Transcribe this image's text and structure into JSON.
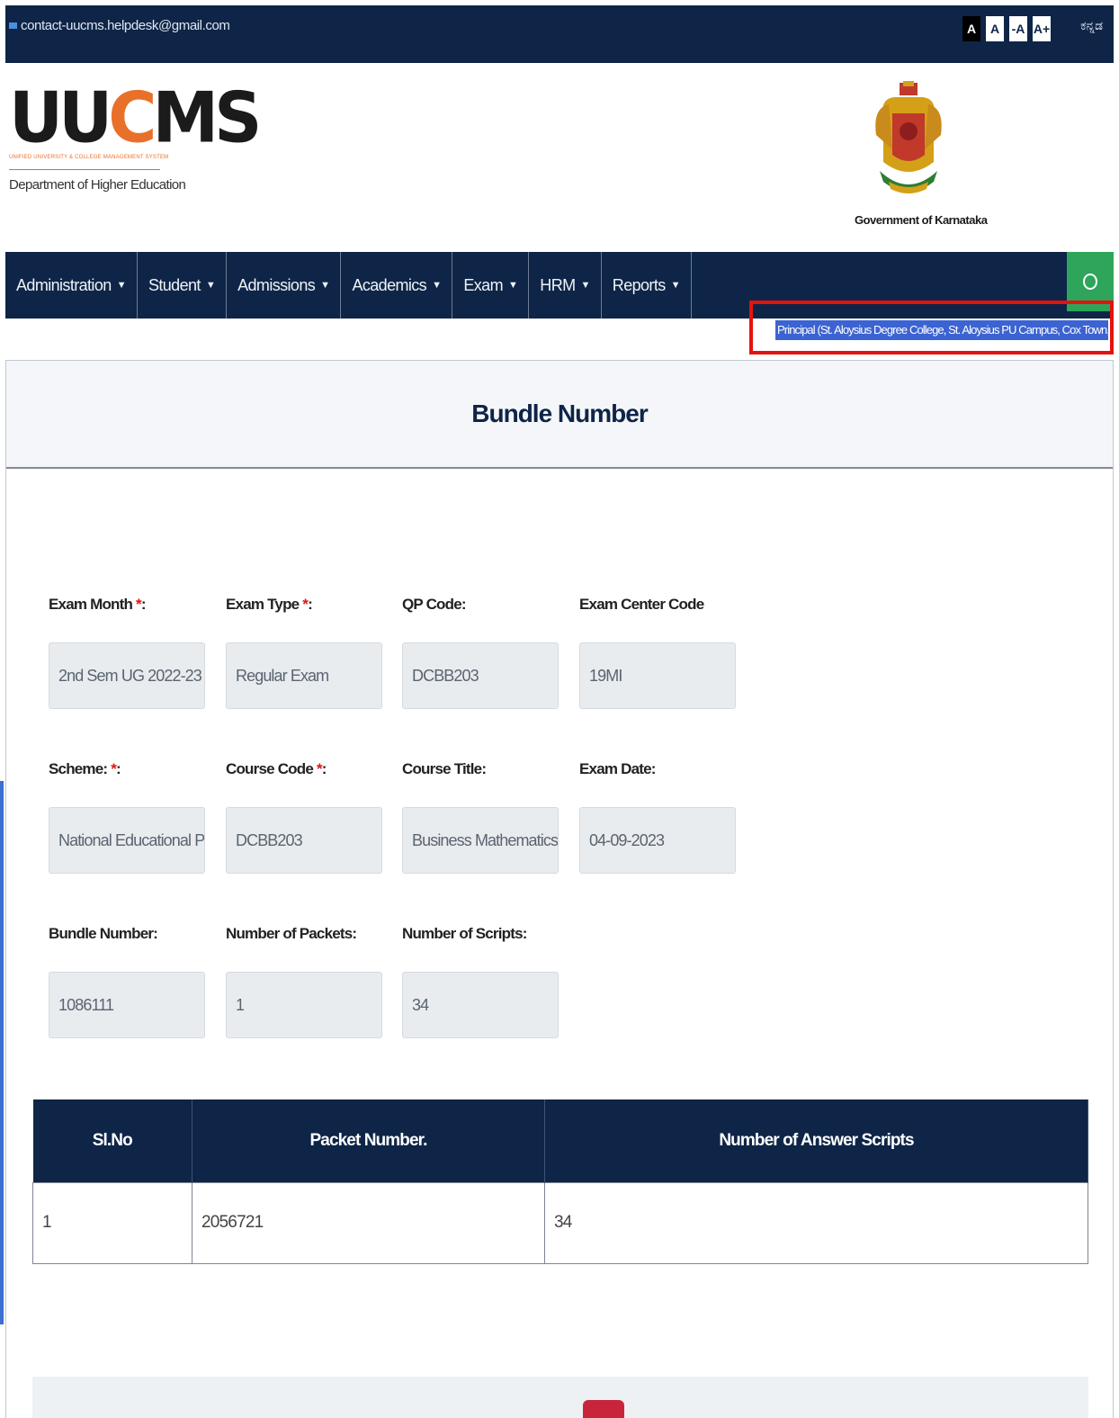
{
  "topbar": {
    "email": "contact-uucms.helpdesk@gmail.com",
    "font_controls": [
      "A",
      "A",
      "-A",
      "A+"
    ],
    "language": "ಕನ್ನಡ"
  },
  "header": {
    "logo_main_left": "UU",
    "logo_main_accent": "C",
    "logo_main_right": "MS",
    "logo_tagline": "UNIFIED UNIVERSITY & COLLEGE MANAGEMENT SYSTEM",
    "department": "Department of Higher Education",
    "emblem_caption": "Government of Karnataka"
  },
  "nav": {
    "items": [
      {
        "label": "Administration"
      },
      {
        "label": "Student"
      },
      {
        "label": "Admissions"
      },
      {
        "label": "Academics"
      },
      {
        "label": "Exam"
      },
      {
        "label": "HRM"
      },
      {
        "label": "Reports"
      }
    ],
    "role": "Principal (St. Aloysius Degree College, St. Aloysius PU Campus, Cox Town, Bengaluru"
  },
  "page": {
    "title": "Bundle Number"
  },
  "form": {
    "exam_month": {
      "label": "Exam Month",
      "req": "*",
      "suffix": ":",
      "value": "2nd Sem UG 2022-23"
    },
    "exam_type": {
      "label": "Exam Type",
      "req": "*",
      "suffix": ":",
      "value": "Regular Exam"
    },
    "qp_code": {
      "label": "QP Code:",
      "value": "DCBB203"
    },
    "exam_center_code": {
      "label": "Exam Center Code",
      "value": "19MI"
    },
    "scheme": {
      "label": "Scheme:",
      "req": "*",
      "suffix": ":",
      "value": "National Educational Policy-"
    },
    "course_code": {
      "label": "Course Code",
      "req": "*",
      "suffix": ":",
      "value": "DCBB203"
    },
    "course_title": {
      "label": "Course Title:",
      "value": "Business Mathematics"
    },
    "exam_date": {
      "label": "Exam Date:",
      "value": "04-09-2023"
    },
    "bundle_number": {
      "label": "Bundle Number:",
      "value": "1086111"
    },
    "number_of_packets": {
      "label": "Number of Packets:",
      "value": "1"
    },
    "number_of_scripts": {
      "label": "Number of Scripts:",
      "value": "34"
    }
  },
  "table": {
    "headers": [
      "Sl.No",
      "Packet Number.",
      "Number of Answer Scripts"
    ],
    "rows": [
      [
        "1",
        "2056721",
        "34"
      ]
    ]
  },
  "colors": {
    "navy": "#0e2547",
    "accent_orange": "#e8702a",
    "highlight_red": "#e3130e",
    "selection_blue": "#3c63d2",
    "user_green": "#2ea55a"
  }
}
